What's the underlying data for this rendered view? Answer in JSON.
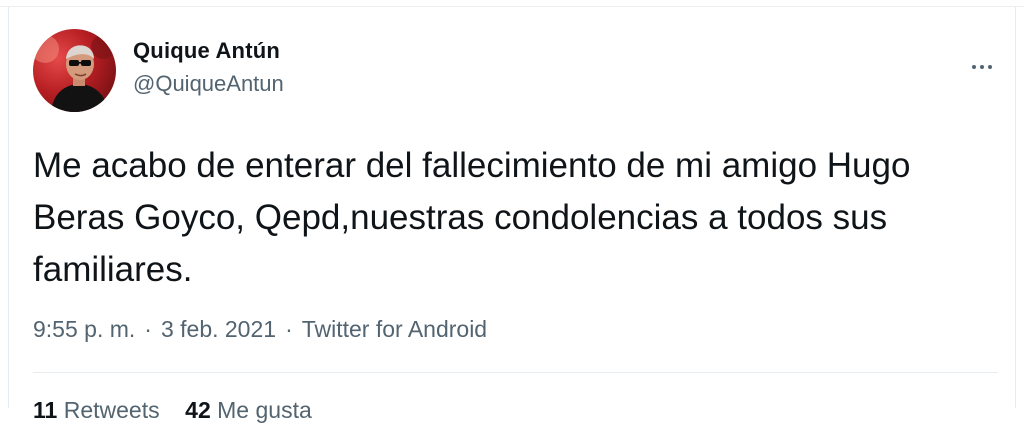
{
  "tweet": {
    "author_name": "Quique Antún",
    "author_handle": "@QuiqueAntun",
    "text": "Me acabo de enterar del fallecimiento de mi amigo Hugo Beras Goyco, Qepd,nuestras condolencias a todos sus familiares.",
    "time": "9:55 p. m.",
    "date": "3 feb. 2021",
    "separator": "·",
    "source": "Twitter for Android"
  },
  "stats": {
    "retweets_count": "11",
    "retweets_label": "Retweets",
    "likes_count": "42",
    "likes_label": "Me gusta"
  },
  "icons": {
    "more": "more-horizontal-icon"
  },
  "colors": {
    "text": "#0f1419",
    "secondary": "#536471",
    "border": "#e6ecf0",
    "avatar_bg": "#b51e22"
  }
}
